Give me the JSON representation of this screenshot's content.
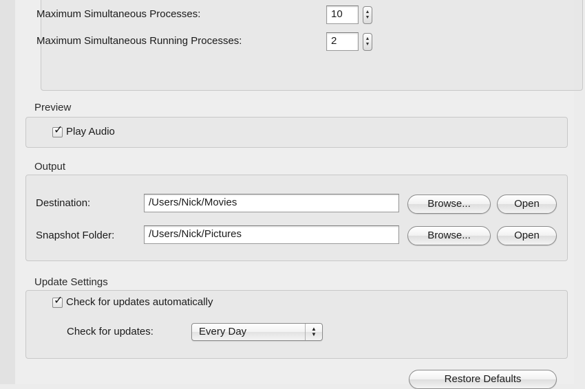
{
  "processes": {
    "max_simultaneous_label": "Maximum Simultaneous Processes:",
    "max_simultaneous_value": "10",
    "max_running_label": "Maximum Simultaneous Running Processes:",
    "max_running_value": "2"
  },
  "preview": {
    "section_label": "Preview",
    "play_audio_label": "Play Audio",
    "play_audio_checked": true
  },
  "output": {
    "section_label": "Output",
    "destination_label": "Destination:",
    "destination_value": "/Users/Nick/Movies",
    "snapshot_label": "Snapshot Folder:",
    "snapshot_value": "/Users/Nick/Pictures",
    "browse_label": "Browse...",
    "open_label": "Open"
  },
  "update": {
    "section_label": "Update Settings",
    "auto_check_label": "Check for updates automatically",
    "auto_check_checked": true,
    "frequency_label": "Check for updates:",
    "frequency_value": "Every Day"
  },
  "footer": {
    "restore_defaults_label": "Restore Defaults"
  },
  "icons": {
    "checkmark": "checkmark-icon",
    "stepper_arrows": "up-down-arrows-icon",
    "popup_arrows": "up-down-arrows-icon"
  }
}
